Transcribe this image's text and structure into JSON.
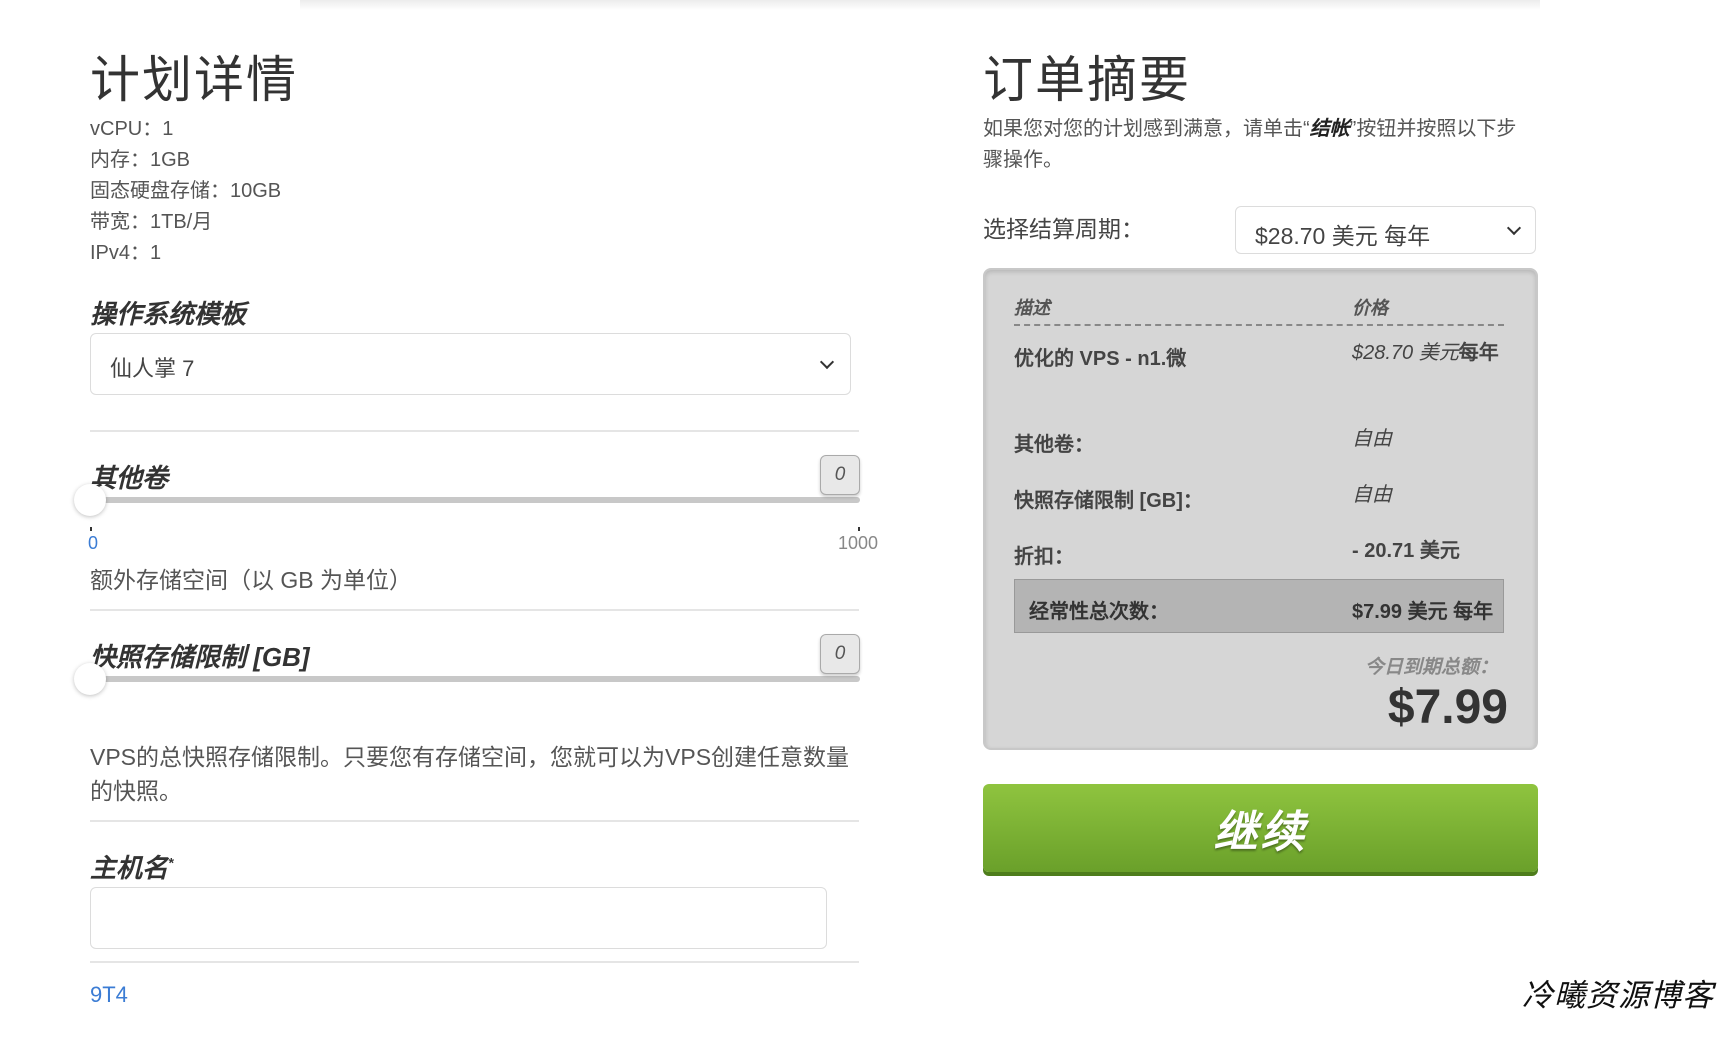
{
  "plan_details": {
    "title": "计划详情",
    "specs": [
      "vCPU：1",
      "内存：1GB",
      "固态硬盘存储：10GB",
      "带宽：1TB/月",
      "IPv4：1"
    ]
  },
  "os_template": {
    "label": "操作系统模板",
    "selected": "仙人掌 7"
  },
  "extra_volume": {
    "label": "其他卷",
    "value": "0",
    "min_label": "0",
    "max_label": "1000",
    "level": 0,
    "description": "额外存储空间（以 GB 为单位）"
  },
  "snapshot_limit": {
    "label": "快照存储限制 [GB]",
    "value": "0",
    "level": 0,
    "description": "VPS的总快照存储限制。只要您有存储空间，您就可以为VPS创建任意数量的快照。"
  },
  "hostname": {
    "label": "主机名",
    "required_mark": "*",
    "value": "",
    "link_text": "9T4"
  },
  "order_summary": {
    "title": "订单摘要",
    "intro_before": "如果您对您的计划感到满意，请单击“",
    "intro_bold": "结帐",
    "intro_after": "”按钮并按照以下步骤操作。",
    "billing_cycle_label": "选择结算周期：",
    "billing_cycle_selected": "$28.70 美元 每年",
    "table_headers": {
      "description": "描述",
      "price": "价格"
    },
    "product_name": "优化的 VPS - n1.微",
    "product_price": "$28.70 美元",
    "product_period": "每年",
    "rows": [
      {
        "label": "其他卷：",
        "value": "自由"
      },
      {
        "label": "快照存储限制 [GB]：",
        "value": "自由"
      }
    ],
    "discount_label": "折扣：",
    "discount_value": "- 20.71 美元",
    "recurring_label": "经常性总次数：",
    "recurring_value": "$7.99 美元 每年",
    "due_today_label": "今日到期总额：",
    "due_today_value": "$7.99"
  },
  "continue_button": "继续",
  "watermark": "冷曦资源博客"
}
